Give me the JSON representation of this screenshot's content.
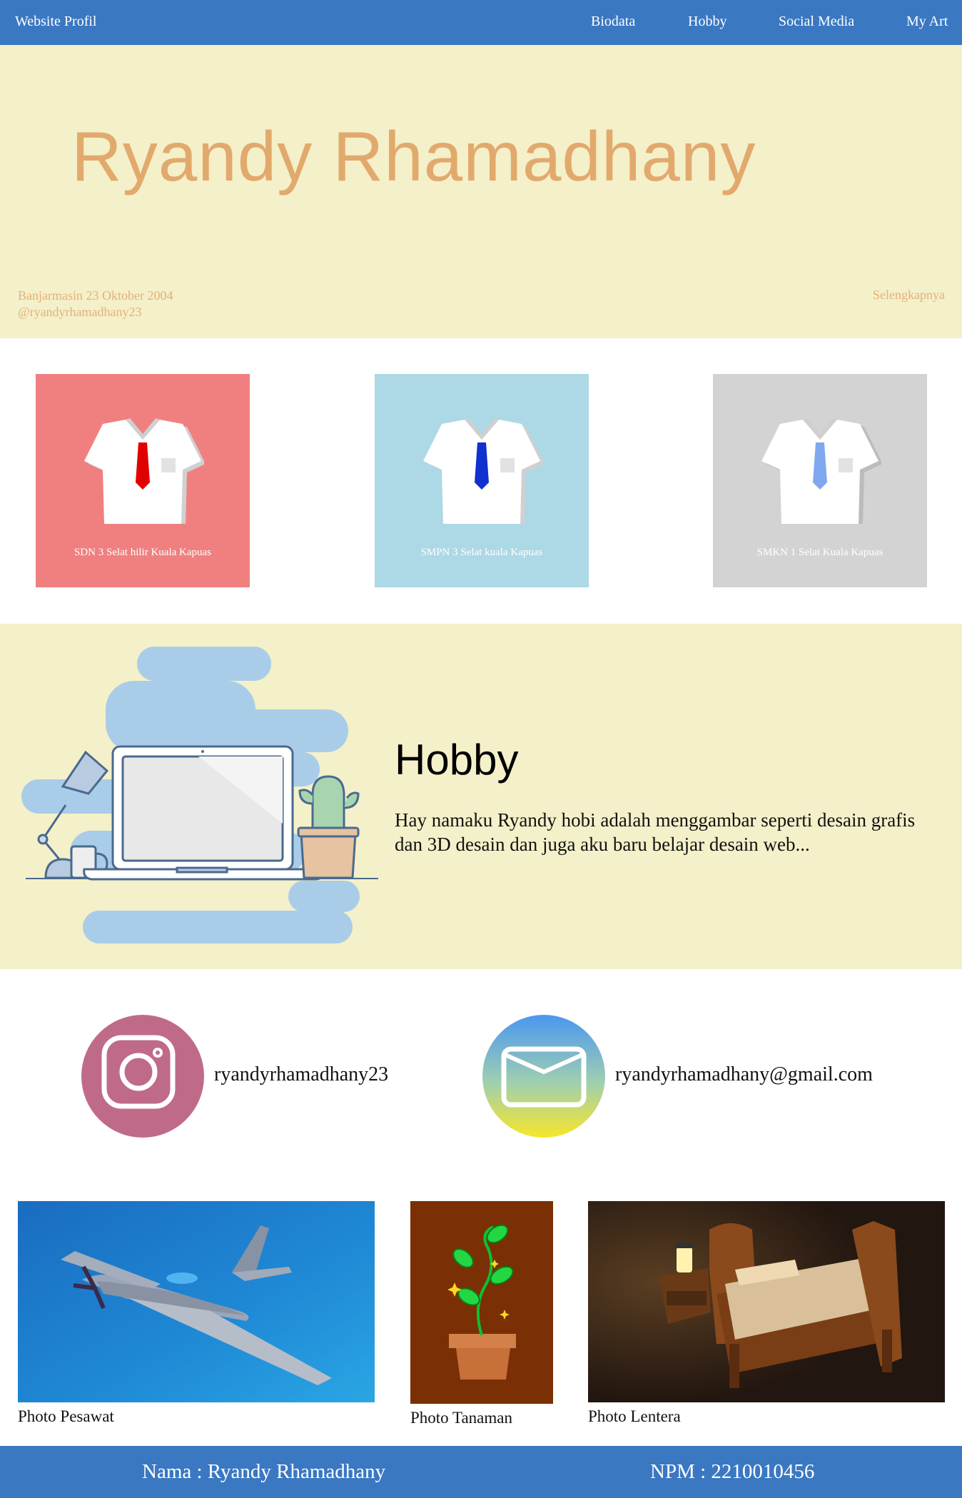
{
  "nav": {
    "brand": "Website Profil",
    "links": [
      "Biodata",
      "Hobby",
      "Social Media",
      "My Art"
    ]
  },
  "hero": {
    "name": "Ryandy Rhamadhany",
    "birth": "Banjarmasin 23 Oktober 2004",
    "handle": "@ryandyrhamadhany23",
    "more": "Selengkapnya"
  },
  "schools": [
    {
      "label": "SDN 3 Selat hilir Kuala Kapuas",
      "bg": "#f08080",
      "tie": "#e00000"
    },
    {
      "label": "SMPN 3 Selat kuala Kapuas",
      "bg": "#add8e6",
      "tie": "#1030d0"
    },
    {
      "label": "SMKN 1 Selat Kuala Kapuas",
      "bg": "#d3d3d3",
      "tie": "#7fa8ee"
    }
  ],
  "hobby": {
    "title": "Hobby",
    "text": "Hay namaku Ryandy hobi adalah menggambar seperti desain grafis dan 3D desain dan juga aku baru belajar desain web..."
  },
  "social": {
    "instagram": "ryandyrhamadhany23",
    "email": "ryandyrhamadhany@gmail.com",
    "icons": [
      "instagram-icon",
      "mail-icon"
    ]
  },
  "art": [
    {
      "caption": "Photo Pesawat"
    },
    {
      "caption": "Photo Tanaman"
    },
    {
      "caption": "Photo Lentera"
    }
  ],
  "footer": {
    "name": "Nama : Ryandy Rhamadhany",
    "npm": "NPM : 2210010456"
  },
  "colors": {
    "nav": "#3a78c2",
    "hero_bg": "#f4f0c9",
    "hero_text": "#e2a96d",
    "instagram": "#c06a8a"
  }
}
